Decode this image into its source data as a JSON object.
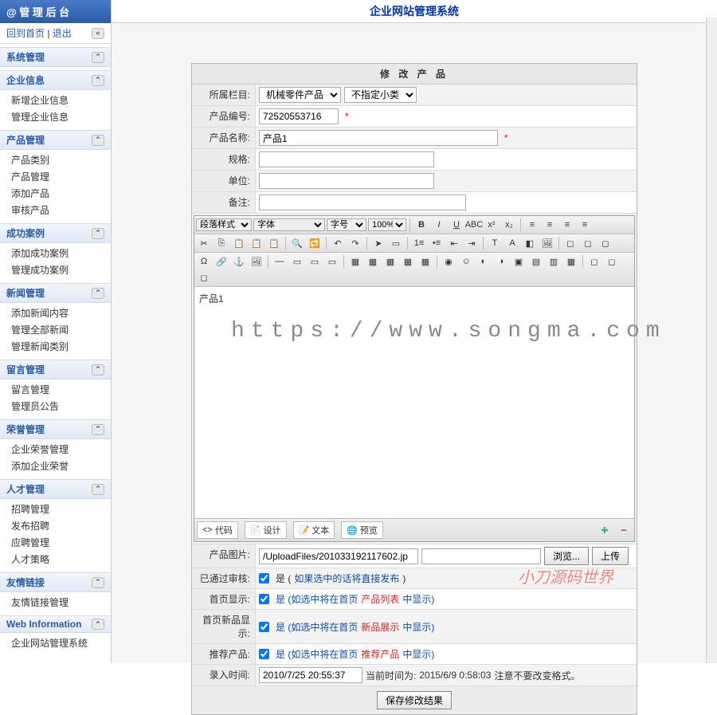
{
  "sidebar": {
    "brand": "@ 管 理 后 台",
    "home": "回到首页",
    "logout": "退出",
    "groups": [
      {
        "title": "系统管理",
        "items": []
      },
      {
        "title": "企业信息",
        "items": [
          "新增企业信息",
          "管理企业信息"
        ]
      },
      {
        "title": "产品管理",
        "items": [
          "产品类别",
          "产品管理",
          "添加产品",
          "审核产品"
        ]
      },
      {
        "title": "成功案例",
        "items": [
          "添加成功案例",
          "管理成功案例"
        ]
      },
      {
        "title": "新闻管理",
        "items": [
          "添加新闻内容",
          "管理全部新闻",
          "管理新闻类别"
        ]
      },
      {
        "title": "留言管理",
        "items": [
          "留言管理",
          "管理员公告"
        ]
      },
      {
        "title": "荣誉管理",
        "items": [
          "企业荣誉管理",
          "添加企业荣誉"
        ]
      },
      {
        "title": "人才管理",
        "items": [
          "招聘管理",
          "发布招聘",
          "应聘管理",
          "人才策略"
        ]
      },
      {
        "title": "友情链接",
        "items": [
          "友情链接管理"
        ]
      },
      {
        "title": "Web Information",
        "items": [
          "企业网站管理系统"
        ]
      }
    ]
  },
  "header": {
    "title": "企业网站管理系统"
  },
  "panel": {
    "title": "修 改 产 品",
    "rows": {
      "category_label": "所属栏目:",
      "category_select1": "机械零件产品",
      "category_select2": "不指定小类",
      "code_label": "产品编号:",
      "code_value": "72520553716",
      "name_label": "产品名称:",
      "name_value": "产品1",
      "spec_label": "规格:",
      "unit_label": "单位:",
      "remark_label": "备注:"
    },
    "editor": {
      "para_style": "段落样式",
      "font": "字体",
      "size": "字号",
      "zoom": "100%",
      "content": "产品1",
      "tabs": {
        "code": "代码",
        "design": "设计",
        "text": "文本",
        "preview": "预览"
      }
    },
    "image": {
      "label": "产品图片:",
      "path": "/UploadFiles/201033192117602.jp",
      "browse": "浏览...",
      "upload": "上传"
    },
    "checks": {
      "approved_label": "已通过审核:",
      "approved_text_pre": "是 (",
      "approved_text_main": "如果选中的话将直接发布",
      "approved_text_post": ")",
      "home_label": "首页显示:",
      "home_text_pre": "是 (如选中将在首页",
      "home_text_red": "产品列表",
      "home_text_post": "中显示)",
      "new_label": "首页新品显示:",
      "new_text_pre": "是 (如选中将在首页",
      "new_text_red": "新品展示",
      "new_text_post": "中显示)",
      "rec_label": "推荐产品:",
      "rec_text_pre": "是 (如选中将在首页",
      "rec_text_red": "推荐产品",
      "rec_text_post": "中显示)"
    },
    "time": {
      "label": "录入时间:",
      "value": "2010/7/25 20:55:37",
      "now_label": "当前时间为: ",
      "now_value": "2015/6/9 0:58:03",
      "note": " 注意不要改变格式。"
    },
    "submit": "保存修改结果"
  },
  "watermark": "https://www.songma.com",
  "watermark2": "小刀源码世界"
}
